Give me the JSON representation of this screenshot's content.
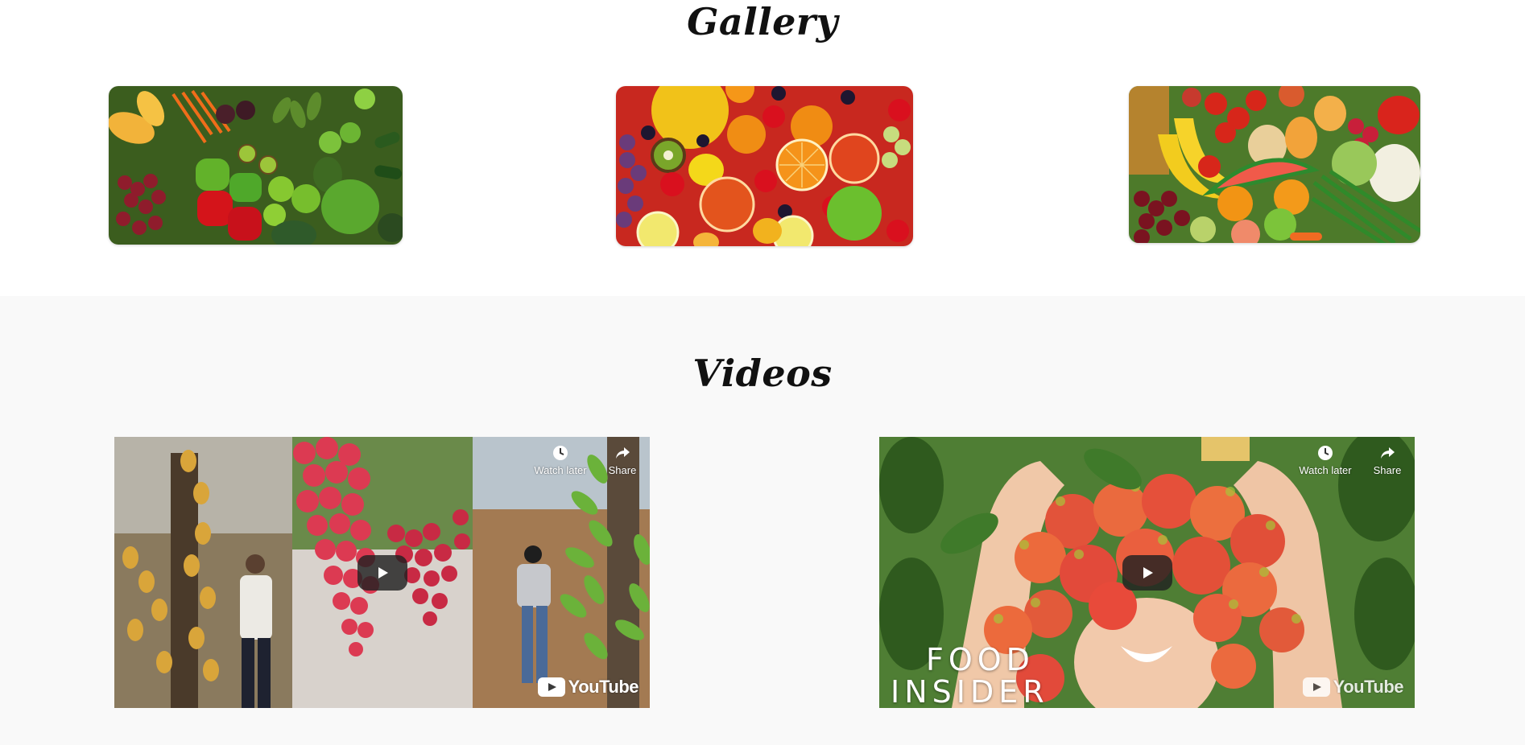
{
  "gallery": {
    "title": "Gallery",
    "images": [
      {
        "name": "vegetables-and-fruits-assortment"
      },
      {
        "name": "citrus-berries-fruit-mix"
      },
      {
        "name": "market-fruit-and-vegetables"
      }
    ]
  },
  "videos": {
    "title": "Videos",
    "items": [
      {
        "watch_later_label": "Watch later",
        "share_label": "Share",
        "youtube_label": "YouTube"
      },
      {
        "watch_later_label": "Watch later",
        "share_label": "Share",
        "youtube_label": "YouTube",
        "overlay_line1": "FOOD",
        "overlay_line2": "INSIDER"
      }
    ]
  },
  "colors": {
    "page_background": "#ffffff",
    "videos_background": "#f9f9f9",
    "play_button": "#212121",
    "youtube_red": "#ff0000"
  },
  "icons": {
    "watch_later": "clock-icon",
    "share": "share-icon",
    "play": "play-icon",
    "youtube": "youtube-icon"
  }
}
